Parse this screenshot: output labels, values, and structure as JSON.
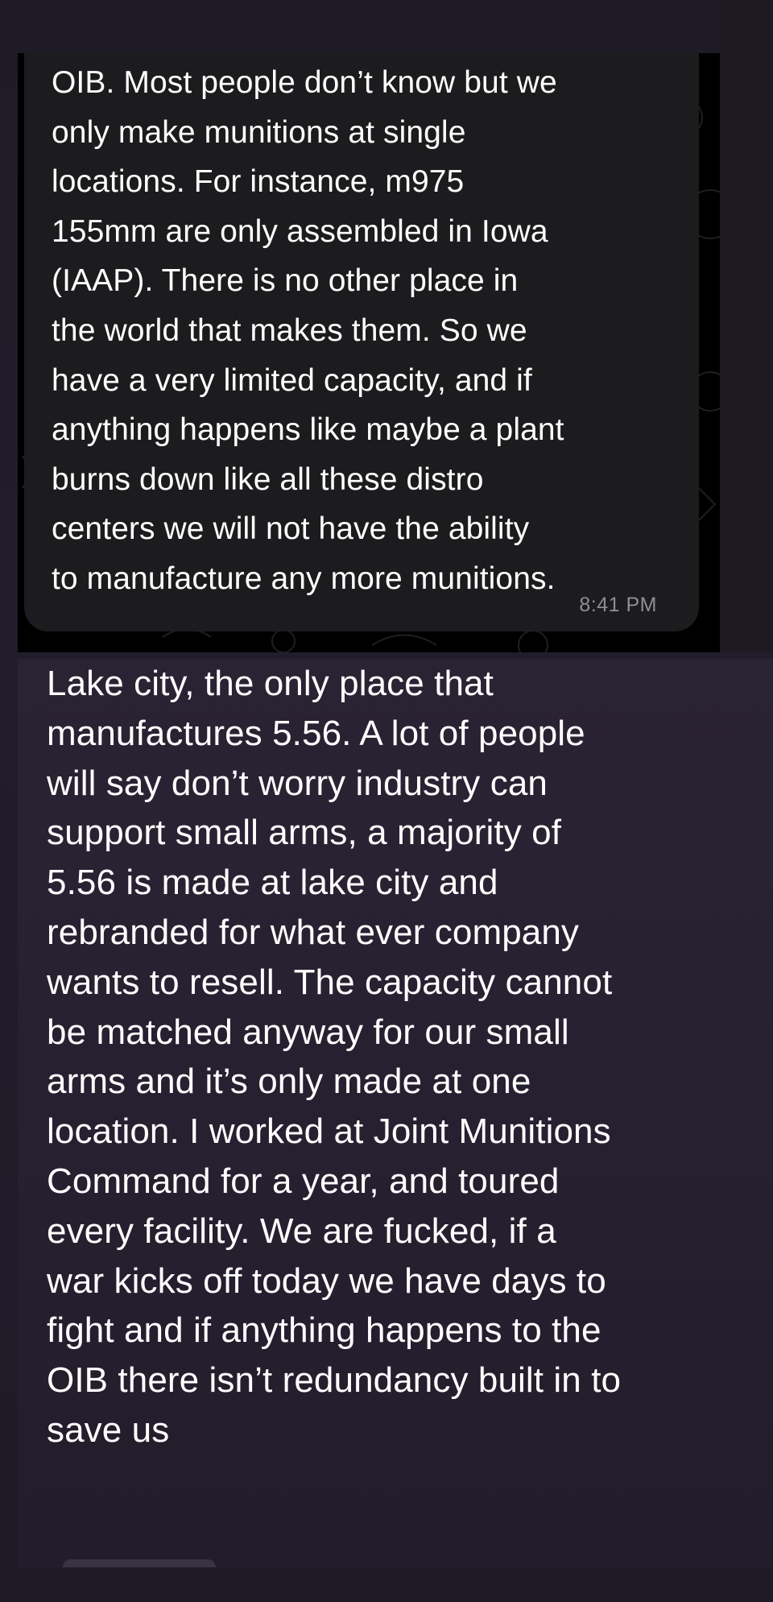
{
  "messages": [
    {
      "text": "OIB. Most people don’t know but we\nonly make munitions at single\nlocations.  For instance, m975\n155mm are only assembled in Iowa\n(IAAP). There is no other place in\nthe world that makes them. So we\nhave a very limited capacity, and if\nanything happens like maybe a plant\nburns down like all these distro\ncenters we will not have the ability\nto manufacture any more munitions.",
      "time": "8:41 PM"
    },
    {
      "text": "Lake city, the only place that\nmanufactures 5.56. A lot of people\nwill say don’t worry industry can\nsupport small arms,  a majority of\n5.56 is made at lake city and\nrebranded for what ever company\nwants to resell. The capacity cannot\nbe matched anyway for our small\narms and it’s only made at one\nlocation.  I worked at Joint Munitions\nCommand for a year, and toured\nevery facility.  We are fucked, if a\nwar kicks off today we have days to\nfight and if anything happens to the\nOIB there isn’t redundancy built in to\nsave us"
    }
  ]
}
